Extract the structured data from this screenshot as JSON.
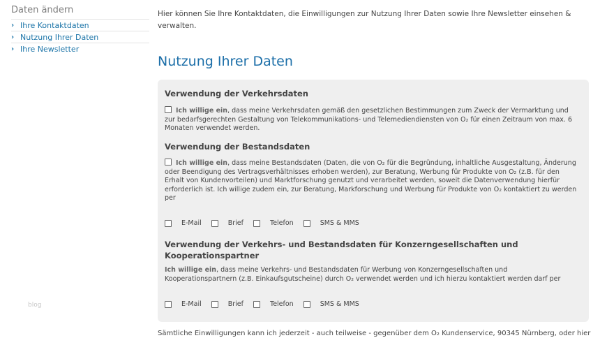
{
  "sidebar": {
    "title": "Daten ändern",
    "items": [
      {
        "label": "Ihre Kontaktdaten"
      },
      {
        "label": "Nutzung Ihrer Daten"
      },
      {
        "label": "Ihre Newsletter"
      }
    ],
    "blog_label": "blog"
  },
  "main": {
    "intro": "Hier können Sie Ihre Kontaktdaten, die Einwilligungen zur Nutzung Ihrer Daten sowie Ihre Newsletter einsehen & verwalten.",
    "section_title": "Nutzung Ihrer Daten",
    "blocks": [
      {
        "heading": "Verwendung der Verkehrsdaten",
        "consent_bold": "Ich willige ein",
        "consent_text": ", dass meine Verkehrsdaten gemäß den gesetzlichen Bestimmungen zum Zweck der Vermarktung und zur bedarfsgerechten Gestaltung von Telekommunikations- und Telemediendiensten von O₂ für einen Zeitraum von max. 6 Monaten verwendet werden."
      },
      {
        "heading": "Verwendung der Bestandsdaten",
        "consent_bold": "Ich willige ein",
        "consent_text": ", dass meine Bestandsdaten (Daten, die von O₂ für die Begründung, inhaltliche Ausgestaltung, Änderung oder Beendigung des Vertragsverhältnisses erhoben werden), zur Beratung, Werbung für Produkte von O₂ (z.B. für den Erhalt von Kundenvorteilen) und Marktforschung genutzt und verarbeitet werden, soweit die Datenverwendung hierfür erforderlich ist. Ich willige zudem ein, zur Beratung, Markforschung und Werbung für Produkte von O₂ kontaktiert zu werden per"
      },
      {
        "heading": "Verwendung der Verkehrs- und Bestandsdaten für Konzerngesellschaften und Kooperationspartner",
        "consent_bold": "Ich willige ein",
        "consent_text": ", dass meine Verkehrs- und Bestandsdaten für Werbung von Konzerngesellschaften und Kooperationspartnern (z.B. Einkaufsgutscheine) durch O₂ verwendet werden und ich hierzu kontaktiert werden darf per"
      }
    ],
    "channels": [
      "E-Mail",
      "Brief",
      "Telefon",
      "SMS & MMS"
    ],
    "footer": "Sämtliche Einwilligungen kann ich jederzeit - auch teilweise - gegenüber dem O₂ Kundenservice, 90345 Nürnberg, oder hier"
  }
}
